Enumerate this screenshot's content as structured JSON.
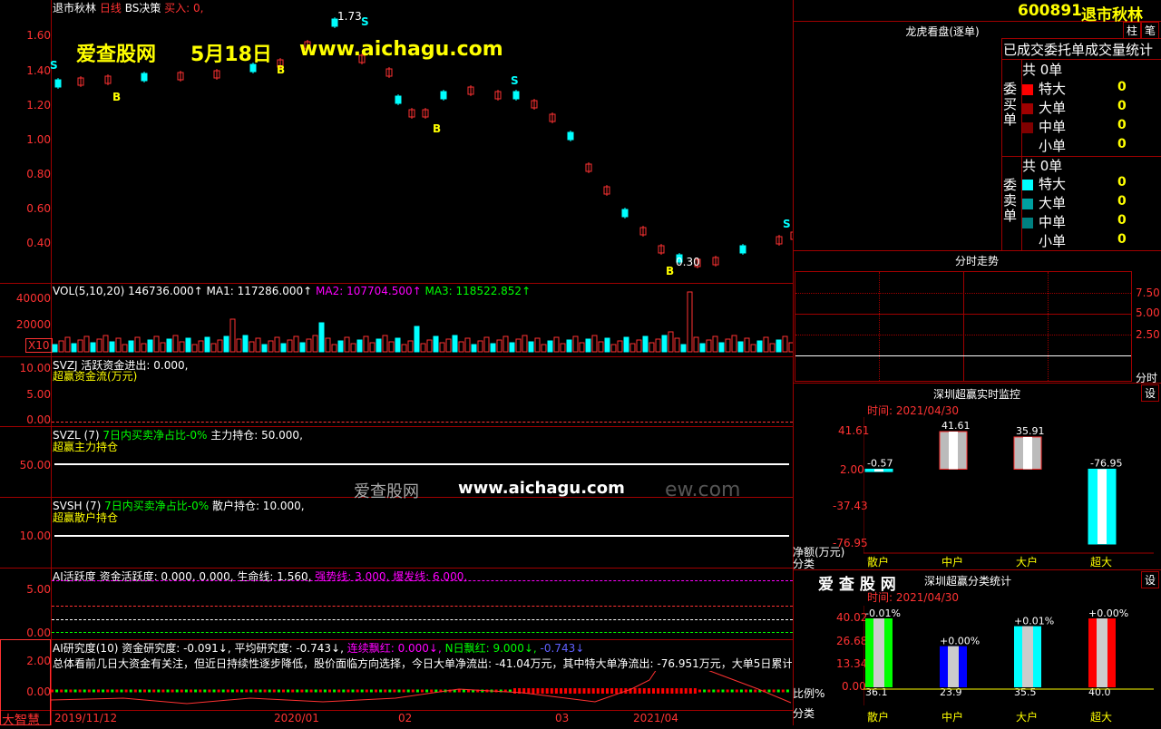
{
  "colors": {
    "up": "#ff3232",
    "down": "#00ffff",
    "grid": "#a00000",
    "label_yellow": "#ffff00"
  },
  "main_chart": {
    "title": "退市秋林",
    "period": "日线",
    "strategy": "BS决策",
    "buy_text": "买入: 0,",
    "price_labels": [
      "1.60",
      "1.40",
      "1.20",
      "1.00",
      "0.80",
      "0.60",
      "0.40"
    ],
    "high_label": "1.73",
    "low_label": "0.30",
    "signals": [
      "S",
      "B",
      "B",
      "S",
      "B",
      "S",
      "B",
      "S"
    ],
    "watermark_site": "爱查股网",
    "watermark_date": "5月18日",
    "watermark_url": "www.aichagu.com"
  },
  "vol_panel": {
    "header": "VOL(5,10,20)",
    "vol": "146736.000↑",
    "ma1": "MA1: 117286.000↑",
    "ma2": "MA2: 107704.500↑",
    "ma3": "MA3: 118522.852↑",
    "axis": [
      "40000",
      "20000"
    ],
    "unit": "X10"
  },
  "svzj": {
    "header": "SVZJ",
    "text": "活跃资金进出: 0.000,",
    "subtitle": "超赢资金流(万元)",
    "axis": [
      "10.00",
      "5.00",
      "0.00"
    ]
  },
  "svzl": {
    "header": "SVZL (7)",
    "text": "7日内买卖净占比-0%",
    "text2": "主力持仓: 50.000,",
    "subtitle": "超赢主力持仓",
    "axis": [
      "50.00"
    ]
  },
  "svsh": {
    "header": "SVSH (7)",
    "text": "7日内买卖净占比-0%",
    "text2": "散户持仓: 10.000,",
    "subtitle": "超赢散户持仓",
    "axis": [
      "10.00"
    ]
  },
  "center_watermark": {
    "site": "爱查股网",
    "url": "www.aichagu.com",
    "fragment": "ew.com"
  },
  "ai_active": {
    "header": "AI活跃度",
    "text": "资金活跃度: 0.000, 0.000, 生命线: 1.560,",
    "strong": "强势线: 3.000,",
    "burst": "爆发线: 6.000,",
    "axis": [
      "5.00",
      "0.00"
    ]
  },
  "ai_research": {
    "header": "AI研究度(10)",
    "r1": "资金研究度: -0.091↓,",
    "r2": "平均研究度: -0.743↓,",
    "r3": "连续飘红: 0.000↓,",
    "r4": "N日飘红: 9.000↓,",
    "r5": "-0.743↓",
    "comment": "总体看前几日大资金有关注，但近日持续性逐步降低，股价面临方向选择，今日大单净流出: -41.04万元，其中特大单净流出: -76.951万元，大单5日累计",
    "axis": [
      "2.00",
      "0.00"
    ]
  },
  "date_axis": {
    "brand": "大智慧",
    "dates": [
      "2019/11/12",
      "2020/01",
      "02",
      "03",
      "2021/04"
    ]
  },
  "side": {
    "code": "600891",
    "name": "退市秋林",
    "btn1": "柱",
    "btn2": "笔",
    "dragon_title": "龙虎看盘(逐单)",
    "stats_title": "已成交委托单成交量统计",
    "buy_group": "委买单",
    "sell_group": "委卖单",
    "buy_total": "共 0单",
    "sell_total": "共 0单",
    "rows": [
      "特大",
      "大单",
      "中单",
      "小单"
    ],
    "buy_vals": [
      "0",
      "0",
      "0",
      "0"
    ],
    "sell_vals": [
      "0",
      "0",
      "0",
      "0"
    ],
    "timeshare_title": "分时走势",
    "timeshare_axis": [
      "7.50",
      "5.00",
      "2.50"
    ],
    "timeshare_unit": "分时",
    "monitor_title": "深圳超赢实时监控",
    "monitor_time": "时间: 2021/04/30",
    "set_label": "设",
    "monitor_axis": [
      "41.61",
      "2.00",
      "-37.43",
      "-76.95"
    ],
    "monitor_unit": "净额(万元)",
    "monitor_xlabel": "分类",
    "monitor_bars": [
      {
        "cat": "散户",
        "value": -0.57,
        "label": "-0.57"
      },
      {
        "cat": "中户",
        "value": 41.61,
        "label": "41.61"
      },
      {
        "cat": "大户",
        "value": 35.91,
        "label": "35.91"
      },
      {
        "cat": "超大",
        "value": -76.95,
        "label": "-76.95"
      }
    ],
    "class_brand": "爱 查 股 网",
    "class_title": "深圳超赢分类统计",
    "class_time": "时间: 2021/04/30",
    "class_axis": [
      "40.02",
      "26.68",
      "13.34",
      "0.00"
    ],
    "class_unit": "比例%",
    "class_xlabel": "分类",
    "class_bars": [
      {
        "cat": "散户",
        "value": 40.02,
        "top": "-0.01%",
        "bottom": "36.1",
        "color": "#00ff00"
      },
      {
        "cat": "中户",
        "value": 23.9,
        "top": "+0.00%",
        "bottom": "23.9",
        "color": "#0000ff"
      },
      {
        "cat": "大户",
        "value": 35.5,
        "top": "+0.01%",
        "bottom": "35.5",
        "color": "#00ffff"
      },
      {
        "cat": "超大",
        "value": 40.0,
        "top": "+0.00%",
        "bottom": "40.0",
        "color": "#ff0000"
      }
    ]
  }
}
